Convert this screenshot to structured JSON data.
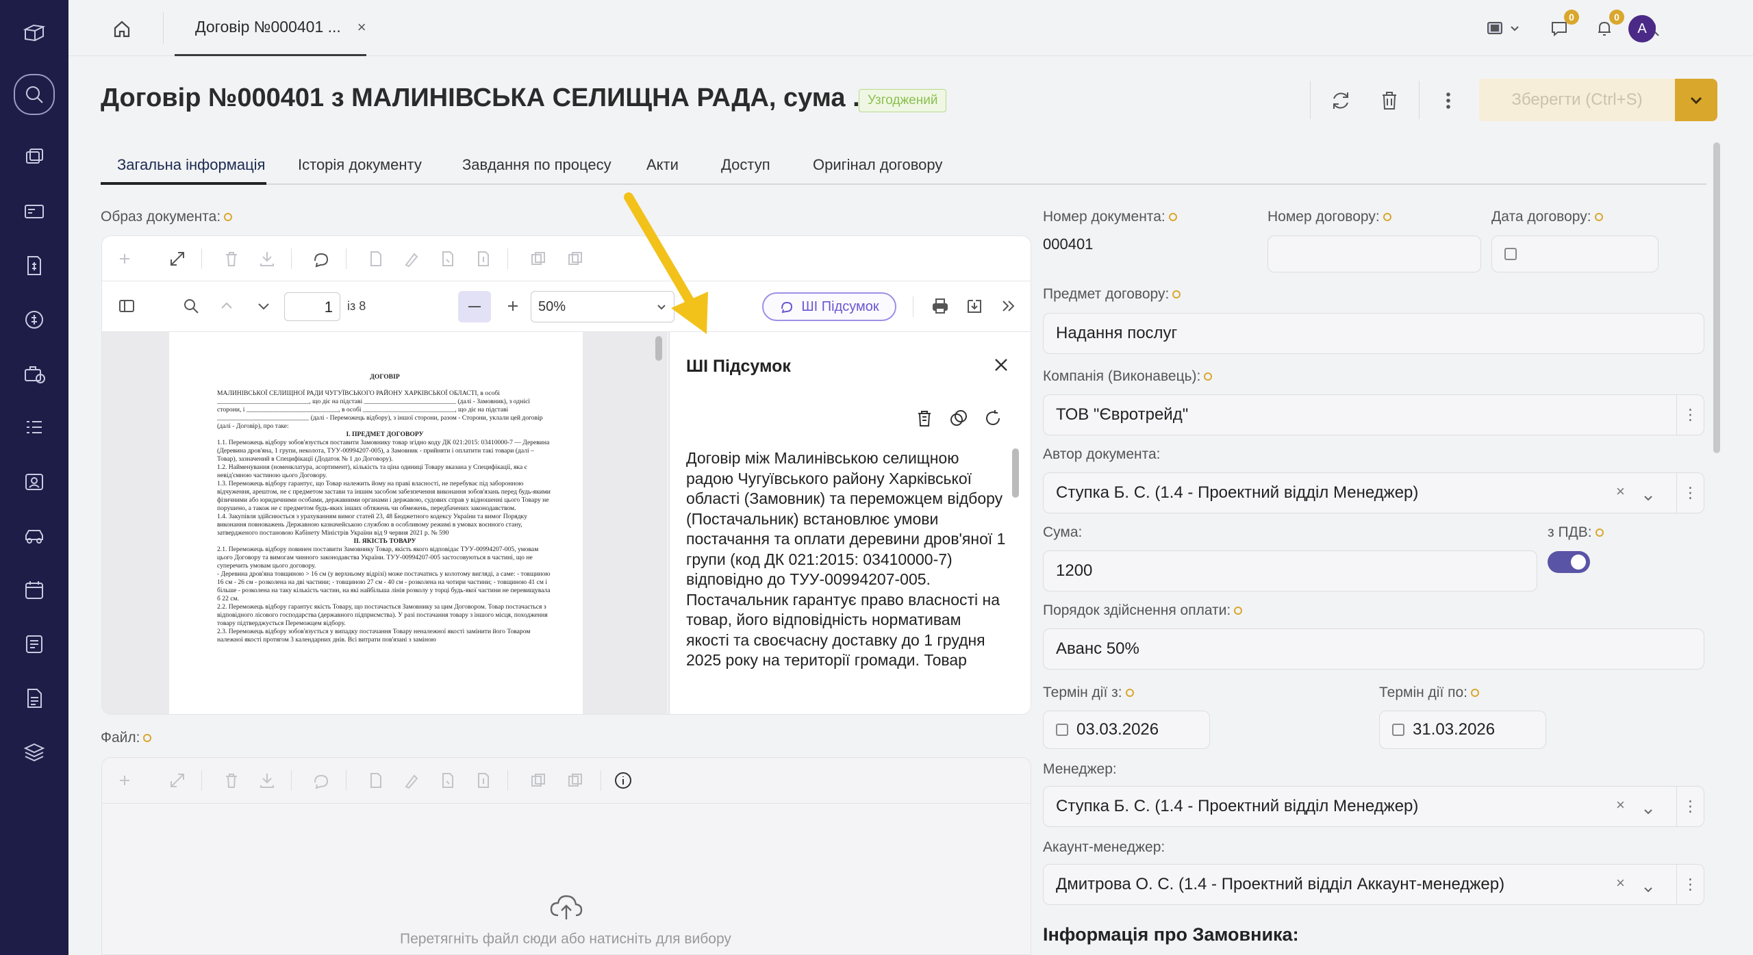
{
  "topbar": {
    "doc_tab_title": "Договір №000401 ...",
    "doc_tab_close": "×",
    "chat_badge": "0",
    "bell_badge": "0",
    "avatar_initial": "A"
  },
  "header": {
    "title": "Договір №000401 з МАЛИНІВСЬКА СЕЛИЩНА РАДА, сума ...",
    "status": "Узгоджений",
    "save_label": "Зберегти (Ctrl+S)"
  },
  "tabs": [
    {
      "label": "Загальна інформація",
      "active": true
    },
    {
      "label": "Історія документу"
    },
    {
      "label": "Завдання по процесу"
    },
    {
      "label": "Акти"
    },
    {
      "label": "Доступ"
    },
    {
      "label": "Оригінал договору"
    }
  ],
  "doc_image": {
    "label": "Образ документа:",
    "page_current": "1",
    "page_total": "із 8",
    "zoom": "50%",
    "ai_button": "ШІ Підсумок",
    "page_lines": [
      "ДОГОВІР",
      "МАЛИНІВСЬКОЇ СЕЛИЩНОЇ РАДИ ЧУГУЇВСЬКОГО РАЙОНУ ХАРКІВСЬКОЇ ОБЛАСТІ, в особі ____________________________, що діє на підставі ____________________________ (далі - Замовник), з однієї сторони, і ____________________________, в особі ____________________________, що діє на підставі ____________________________ (далі - Переможець відбору), з іншої сторони, разом - Сторони, уклали цей договір (далі - Договір), про таке:",
      "I. ПРЕДМЕТ ДОГОВОРУ",
      "1.1. Переможець відбору зобов'язується поставити Замовнику товар згідно коду ДК 021:2015: 03410000-7 — Деревина (Деревина дров'яна, 1 групи, неколота, ТУУ-00994207-005), а Замовник - прийняти і оплатити такі товари (далі – Товар), зазначений в Специфікації (Додаток № 1 до Договору).",
      "1.2. Найменування (номенклатура, асортимент), кількість та ціна одиниці Товару вказана у Специфікації, яка є невід'ємною частиною цього Договору.",
      "1.3. Переможець відбору гарантує, що Товар належить йому на праві власності, не перебуває під заборонною відчуження, арештом, не є предметом застави та іншим засобом забезпечення виконання зобов'язань перед будь-якими фізичними або юридичними особами, державними органами і державою, судових справ у відношенні цього Товару не порушено, а також не є предметом будь-яких інших обтяжень чи обмежень, передбачених законодавством.",
      "1.4. Закупівля здійснюється з урахуванням вимог статей 23, 48 Бюджетного кодексу України та вимог Порядку виконання повноважень Державною казначейською службою в особливому режимі в умовах воєнного стану, затвердженого постановою Кабінету Міністрів України від 9 червня 2021 р. № 590",
      "II. ЯКІСТЬ ТОВАРУ",
      "2.1. Переможець відбору повинен поставити Замовнику Товар, якість якого відповідає ТУУ-00994207-005, умовам цього Договору та вимогам чинного законодавства України. ТУУ-00994207-005 застосовуються в частині, що не суперечить умовам цього договору.",
      "- Деревина дров'яна товщиною > 16 см (у верхньому відрізі) може постачатись у колотому вигляді, а саме: - товщиною 16 см - 26 см - розколена на дві частини; - товщиною 27 см - 40 см - розколена на чотири частини; - товщиною 41 см і більше - розколена на таку кількість частин, на які найбільша лінія розколу у торці будь-якої частини не перевищувала б 22 см.",
      "2.2. Переможець відбору гарантує якість Товару, що постачається Замовнику за цим Договором. Товар постачається з відповідного лісового господарства (державного підприємства). У разі постачання товару з іншого місця, походження товару підтверджується Переможцем відбору.",
      "2.3. Переможець відбору зобов'язується у випадку постачання Товару неналежної якості замінити його Товаром належної якості протягом 3 календарних днів. Всі витрати пов'язані з заміною"
    ]
  },
  "ai_panel": {
    "title": "ШІ Підсумок",
    "summary": "Договір між Малинівською селищною радою Чугуївського району Харківської області (Замовник) та переможцем відбору (Постачальник) встановлює умови постачання та оплати деревини дров'яної 1 групи (код ДК 021:2015: 03410000-7) відповідно до ТУУ-00994207-005. Постачальник гарантує право власності на товар, його відповідність нормативам якості та своєчасну доставку до 1 грудня 2025 року на території громади. Товар"
  },
  "file": {
    "label": "Файл:",
    "drop_text": "Перетягніть файл сюди або натисніть для вибору"
  },
  "form": {
    "doc_number_label": "Номер документа:",
    "doc_number": "000401",
    "contract_number_label": "Номер договору:",
    "contract_number": "",
    "contract_date_label": "Дата договору:",
    "subject_label": "Предмет договору:",
    "subject": "Надання послуг",
    "company_label": "Компанія (Виконавець):",
    "company": "ТОВ \"Євротрейд\"",
    "author_label": "Автор документа:",
    "author": "Ступка Б. С. (1.4 - Проектний відділ Менеджер)",
    "sum_label": "Сума:",
    "sum": "1200",
    "vat_label": "з ПДВ:",
    "vat_on": true,
    "payment_label": "Порядок здійснення оплати:",
    "payment": "Аванс 50%",
    "valid_from_label": "Термін дії з:",
    "valid_from": "03.03.2026",
    "valid_to_label": "Термін дії по:",
    "valid_to": "31.03.2026",
    "manager_label": "Менеджер:",
    "manager": "Ступка Б. С. (1.4 - Проектний відділ Менеджер)",
    "account_manager_label": "Акаунт-менеджер:",
    "account_manager": "Дмитрова О. С. (1.4 - Проектний відділ Аккаунт-менеджер)",
    "customer_section": "Інформація про Замовника:"
  },
  "colors": {
    "rail": "#1d1d48",
    "accent": "#d9a72c",
    "ai": "#6a57cf",
    "status_green": "#8bbf4f"
  }
}
